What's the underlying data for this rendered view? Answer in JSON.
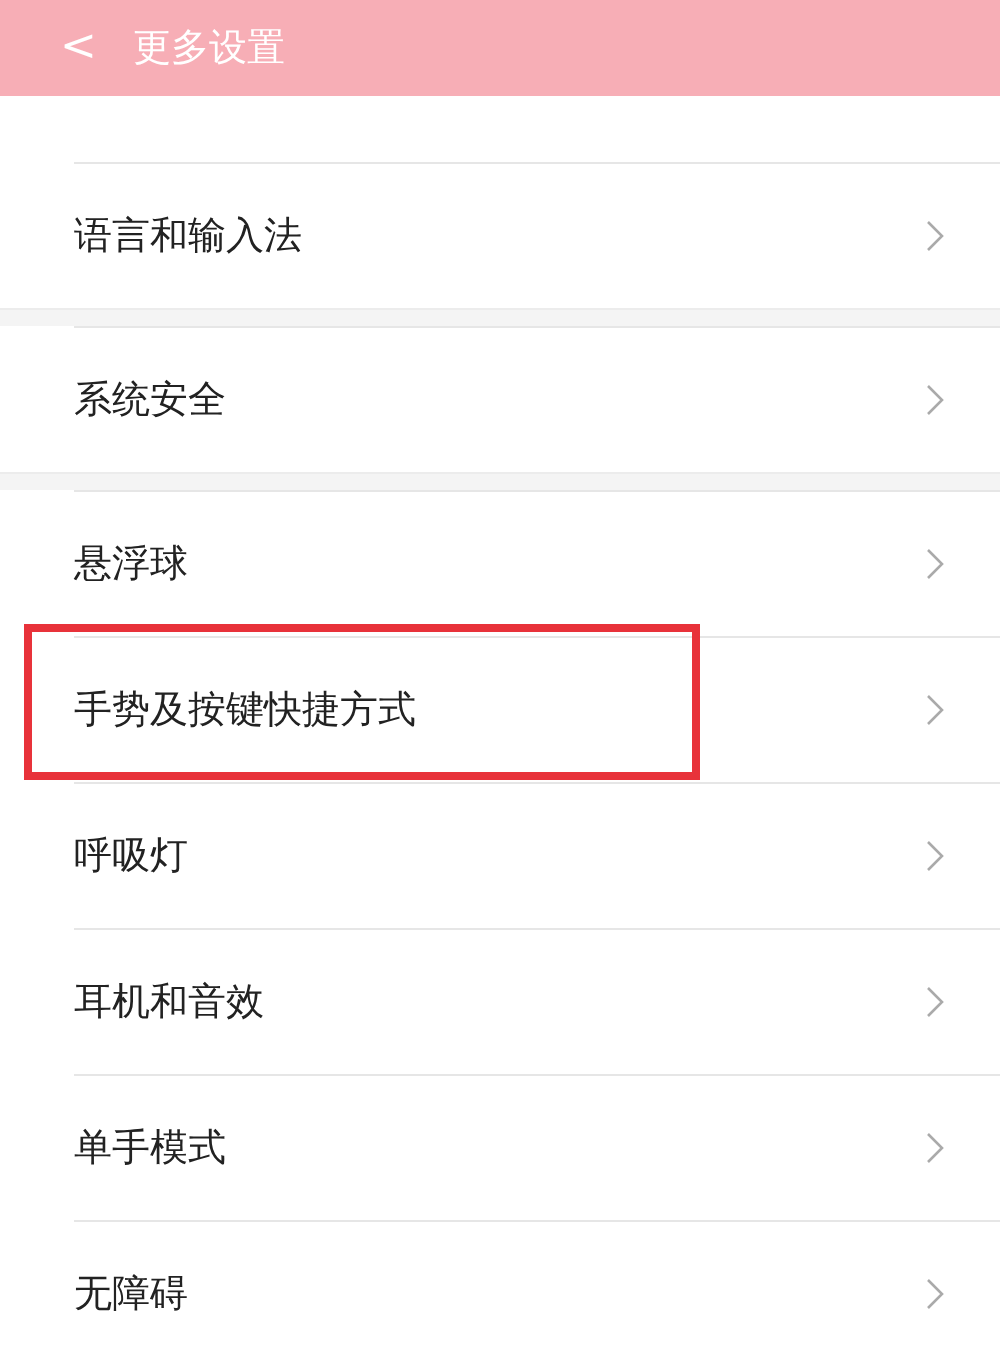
{
  "header": {
    "back": "<",
    "title": "更多设置"
  },
  "groups": [
    {
      "items": [
        {
          "label": "语言和输入法",
          "highlighted": false
        }
      ]
    },
    {
      "items": [
        {
          "label": "系统安全",
          "highlighted": false
        }
      ]
    },
    {
      "items": [
        {
          "label": "悬浮球",
          "highlighted": false
        },
        {
          "label": "手势及按键快捷方式",
          "highlighted": true
        },
        {
          "label": "呼吸灯",
          "highlighted": false
        },
        {
          "label": "耳机和音效",
          "highlighted": false
        },
        {
          "label": "单手模式",
          "highlighted": false
        },
        {
          "label": "无障碍",
          "highlighted": false
        }
      ]
    }
  ]
}
